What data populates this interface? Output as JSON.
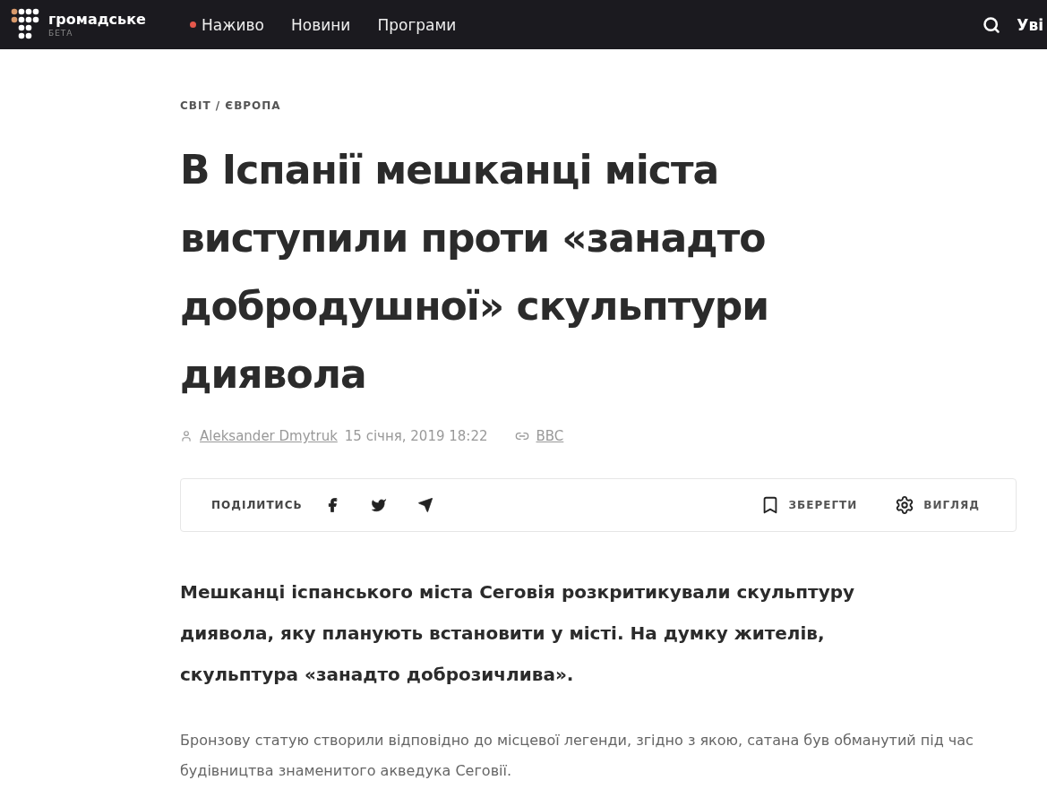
{
  "header": {
    "logo": {
      "name": "громадське",
      "tag": "БЕТА"
    },
    "nav": [
      {
        "label": "Наживо",
        "live": true
      },
      {
        "label": "Новини",
        "live": false
      },
      {
        "label": "Програми",
        "live": false
      }
    ],
    "login": "Уві"
  },
  "article": {
    "breadcrumb": "СВІТ / ЄВРОПА",
    "title": "В Іспанії мешканці міста виступили проти «занадто добродушної» скульптури диявола",
    "author": "Aleksander Dmytruk",
    "date": "15 січня, 2019 18:22",
    "source": "BBC",
    "share": {
      "label": "ПОДІЛИТИСЬ",
      "networks": [
        {
          "kind": "facebook"
        },
        {
          "kind": "twitter"
        },
        {
          "kind": "telegram"
        }
      ]
    },
    "actions": [
      {
        "kind": "save",
        "label": "ЗБЕРЕГТИ"
      },
      {
        "kind": "view",
        "label": "ВИГЛЯД"
      }
    ],
    "lead": "Мешканці іспанського міста Сеговія розкритикували скульптуру диявола, яку планують встановити у місті. На думку жителів, скульптура «занадто доброзичлива».",
    "body": "Бронзову статую створили відповідно до місцевої легенди, згідно з якою, сатана був обманутий під час будівництва знаменитого акведука Сеговії."
  }
}
